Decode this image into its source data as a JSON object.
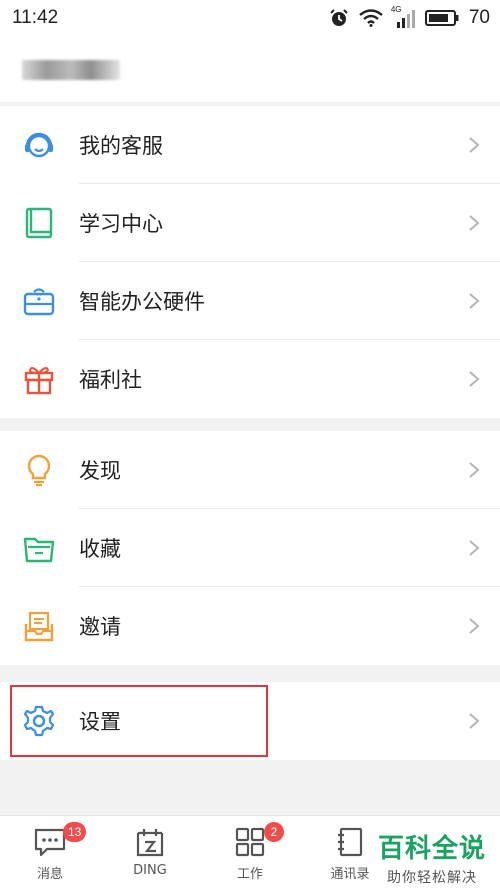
{
  "status_bar": {
    "time": "11:42",
    "network": "4G",
    "battery": "70"
  },
  "menu_group_1": [
    {
      "label": "我的客服",
      "icon": "headset-icon",
      "color": "#3a8ee6"
    },
    {
      "label": "学习中心",
      "icon": "book-icon",
      "color": "#2bb57a"
    },
    {
      "label": "智能办公硬件",
      "icon": "device-icon",
      "color": "#3a8ee6"
    },
    {
      "label": "福利社",
      "icon": "gift-icon",
      "color": "#e8533c"
    }
  ],
  "menu_group_2": [
    {
      "label": "发现",
      "icon": "lightbulb-icon",
      "color": "#f0a23a"
    },
    {
      "label": "收藏",
      "icon": "folder-icon",
      "color": "#2bb57a"
    },
    {
      "label": "邀请",
      "icon": "envelope-icon",
      "color": "#f0a23a"
    }
  ],
  "menu_group_3": [
    {
      "label": "设置",
      "icon": "gear-icon",
      "color": "#3a8ee6"
    }
  ],
  "tabs": [
    {
      "label": "消息",
      "badge": "13"
    },
    {
      "label": "DING",
      "badge": ""
    },
    {
      "label": "工作",
      "badge": "2"
    },
    {
      "label": "通讯录",
      "badge": ""
    }
  ],
  "watermark": {
    "title": "百科全说",
    "subtitle": "助你轻松解决"
  }
}
